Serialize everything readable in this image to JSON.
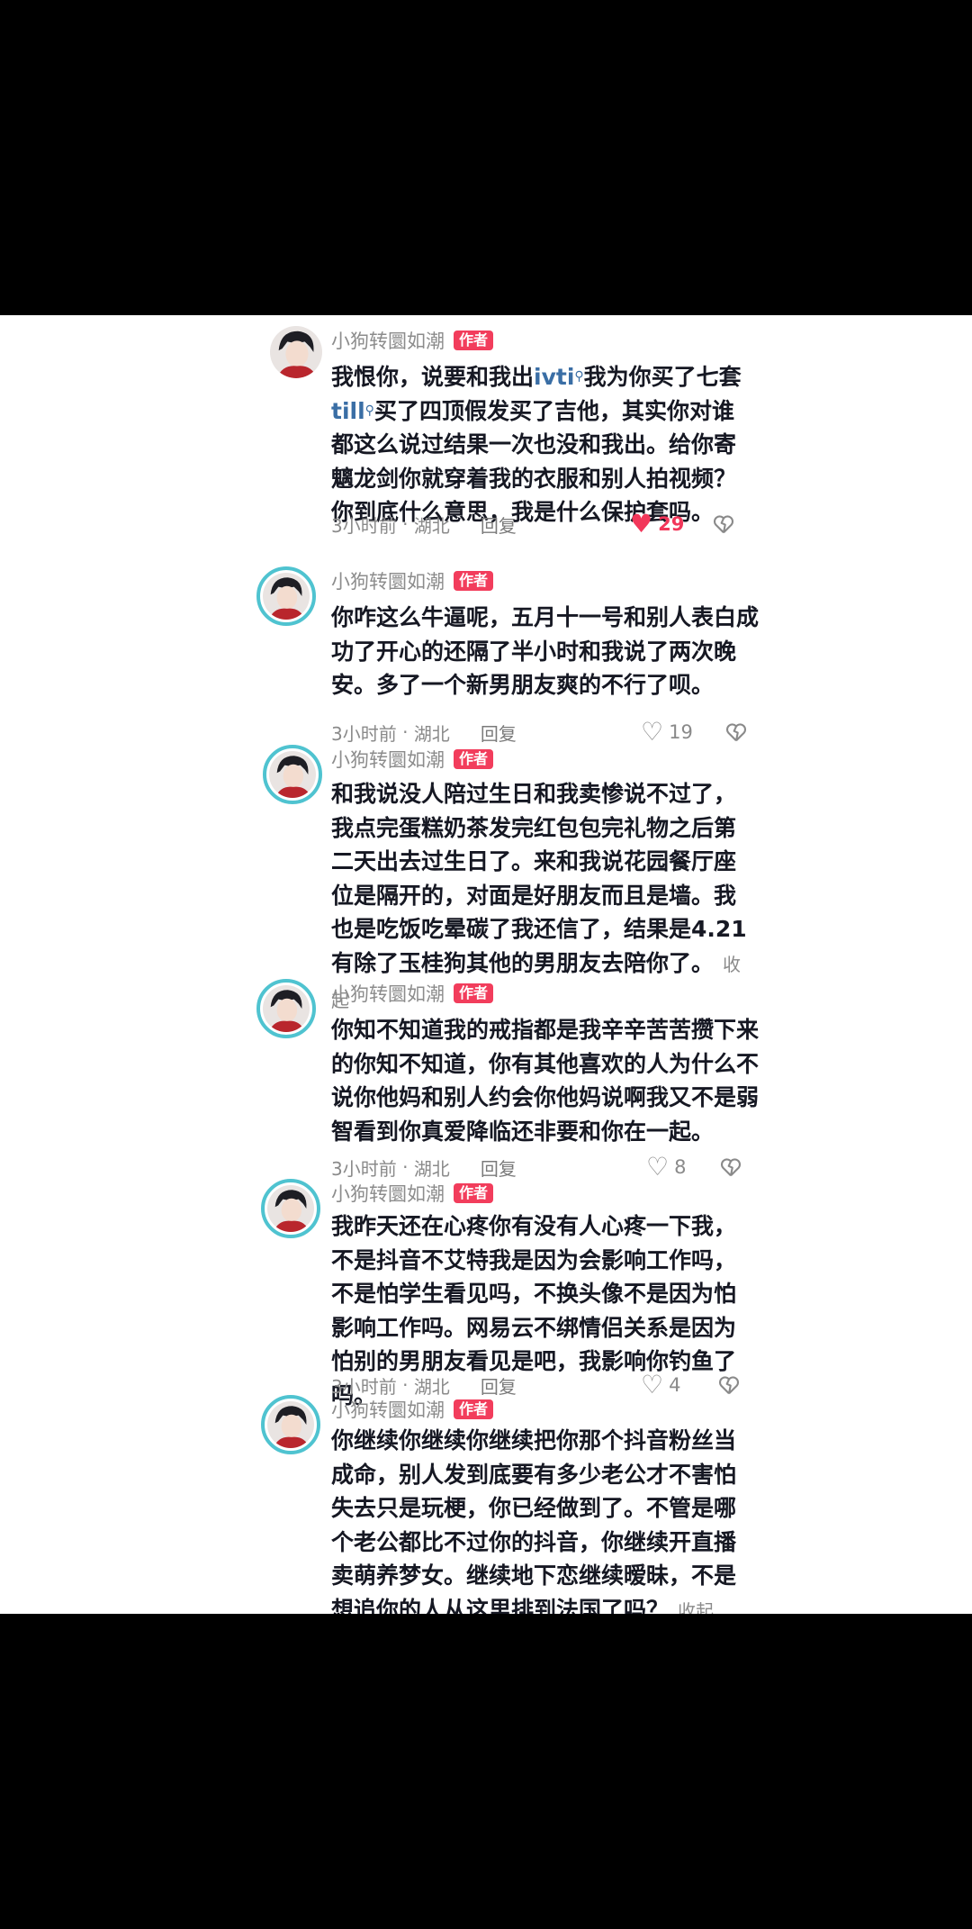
{
  "comments": [
    {
      "username": "小狗转圜如潮",
      "badge": "作者",
      "text_parts": [
        "我恨你，说要和我出",
        "ivti",
        "我为你买了七套",
        "till",
        "买了四顶假发买了吉他，其实你对谁都这么说过结果一次也没和我出。给你寄魑龙剑你就穿着我的衣服和别人拍视频？你到底什么意思，我是什么保护套吗。"
      ],
      "time": "3小时前",
      "location": "湖北",
      "reply": "回复",
      "likes": "29",
      "liked": true
    },
    {
      "username": "小狗转圜如潮",
      "badge": "作者",
      "text": "你咋这么牛逼呢，五月十一号和别人表白成功了开心的还隔了半小时和我说了两次晚安。多了一个新男朋友爽的不行了呗。",
      "time": "3小时前",
      "location": "湖北",
      "reply": "回复",
      "likes": "19"
    },
    {
      "username": "小狗转圜如潮",
      "badge": "作者",
      "text": "和我说没人陪过生日和我卖惨说不过了，我点完蛋糕奶茶发完红包包完礼物之后第二天出去过生日了。来和我说花园餐厅座位是隔开的，对面是好朋友而且是墙。我也是吃饭吃晕碳了我还信了，结果是4.21有除了玉桂狗其他的男朋友去陪你了。",
      "collapse": "收起"
    },
    {
      "username": "小狗转圜如潮",
      "badge": "作者",
      "text": "你知不知道我的戒指都是我辛辛苦苦攒下来的你知不知道，你有其他喜欢的人为什么不说你他妈和别人约会你他妈说啊我又不是弱智看到你真爱降临还非要和你在一起。",
      "time": "3小时前",
      "location": "湖北",
      "reply": "回复",
      "likes": "8"
    },
    {
      "username": "小狗转圜如潮",
      "badge": "作者",
      "text": "我昨天还在心疼你有没有人心疼一下我，不是抖音不艾特我是因为会影响工作吗，不是怕学生看见吗，不换头像不是因为怕影响工作吗。网易云不绑情侣关系是因为怕别的男朋友看见是吧，我影响你钓鱼了吗。",
      "time": "3小时前",
      "location": "湖北",
      "reply": "回复",
      "likes": "4"
    },
    {
      "username": "小狗转圜如潮",
      "badge": "作者",
      "text": "你继续你继续你继续把你那个抖音粉丝当成命，别人发到底要有多少老公才不害怕失去只是玩梗，你已经做到了。不管是哪个老公都比不过你的抖音，你继续开直播卖萌养梦女。继续地下恋继续暧昧，不是想追你的人从这里排到法国了吗？",
      "collapse": "收起"
    }
  ],
  "meta_sep": "·",
  "icons": {
    "like": "heart-icon",
    "dislike": "broken-heart-icon",
    "search_hint": "search-icon"
  },
  "colors": {
    "liked": "#f2375a",
    "badge": "#f23d5c",
    "keyword": "#3a6ea5",
    "ring": "#4fc3d0"
  }
}
